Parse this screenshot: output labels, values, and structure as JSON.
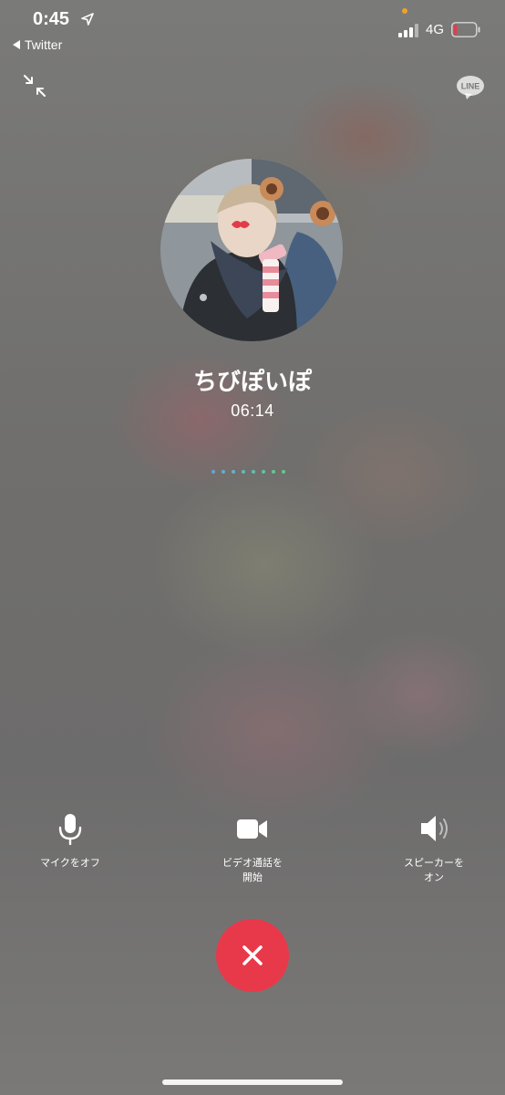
{
  "status_bar": {
    "time": "0:45",
    "back_app": "Twitter",
    "network": "4G",
    "icons": [
      "location-arrow-icon",
      "signal-icon",
      "battery-low-icon"
    ],
    "battery_color": "#e8394b",
    "privacy_dot_color": "#f0a12a"
  },
  "top_controls": {
    "minimize_icon": "minimize-icon",
    "logo_text": "LINE"
  },
  "call": {
    "contact_name": "ちびぽいぽ",
    "duration": "06:14",
    "dot_colors": [
      "#5fa9d6",
      "#5fb0cf",
      "#60b6c6",
      "#60bbbb",
      "#61c0ad",
      "#62c4a0",
      "#63c793",
      "#64c987"
    ]
  },
  "controls": {
    "mic_label": "マイクをオフ",
    "video_label": "ビデオ通話を\n開始",
    "speaker_label": "スピーカーを\nオン"
  },
  "end_call": {
    "icon": "close-icon",
    "color": "#e8394b"
  }
}
